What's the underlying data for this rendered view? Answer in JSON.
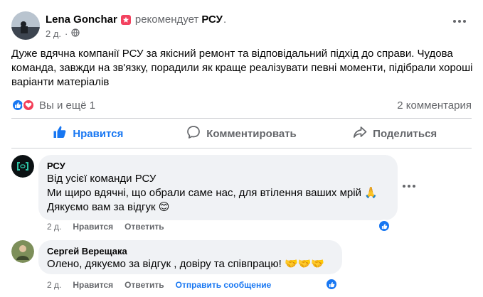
{
  "post": {
    "author": "Lena Gonchar",
    "recommends_text": "рекомендует",
    "page": "РСУ",
    "dot": ".",
    "time": "2 д.",
    "body": "Дуже вдячна компанії РСУ за якісний ремонт та відповідальний підхід до справи. Чудова команда, завжди на зв'язку, порадили як краще реалізувати певні моменти, підібрали хороші варіанти матеріалів"
  },
  "reactions": {
    "summary": "Вы и ещё 1",
    "comments_count": "2 комментария"
  },
  "actions": {
    "like": "Нравится",
    "comment": "Комментировать",
    "share": "Поделиться"
  },
  "comments": [
    {
      "author": "РСУ",
      "lines": [
        "Від усієї команди РСУ",
        "Ми щиро вдячні, що обрали саме нас, для втілення ваших мрій 🙏",
        "Дякуємо вам за відгук 😊"
      ],
      "time": "2 д.",
      "like_label": "Нравится",
      "reply_label": "Ответить"
    },
    {
      "author": "Сергей Верещака",
      "lines": [
        "Олено, дякуємо за відгук , довіру та співпрацю! 🤝🤝🤝"
      ],
      "time": "2 д.",
      "like_label": "Нравится",
      "reply_label": "Ответить",
      "edit_label": "Отправить сообщение"
    }
  ],
  "colors": {
    "brand_blue": "#1877f2",
    "love_red": "#f33e58",
    "badge_pink": "#f3425f",
    "secondary_text": "#65676b",
    "bubble_bg": "#f0f2f5"
  },
  "icons": [
    "globe-icon",
    "more-icon",
    "like-reaction-icon",
    "love-reaction-icon",
    "thumbs-up-icon",
    "comment-icon",
    "share-icon",
    "recommend-badge-icon"
  ]
}
